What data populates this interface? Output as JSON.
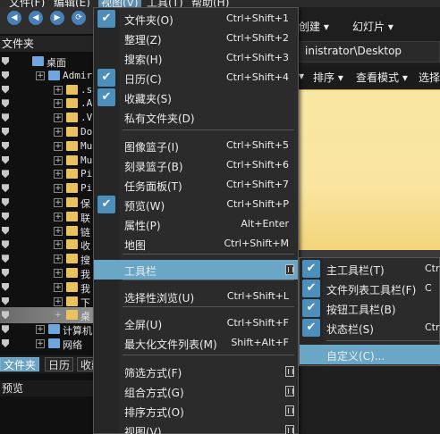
{
  "menubar": {
    "items": [
      {
        "label": "文件(F)"
      },
      {
        "label": "编辑(E)"
      },
      {
        "label": "视图(V)",
        "active": true
      },
      {
        "label": "工具(T)"
      },
      {
        "label": "帮助(H)"
      }
    ]
  },
  "left_panel": {
    "title": "文件夹",
    "tree": [
      {
        "label": "桌面",
        "indent": 1
      },
      {
        "label": "Admir",
        "indent": 2
      },
      {
        "label": ".s",
        "indent": 3
      },
      {
        "label": ".A",
        "indent": 3
      },
      {
        "label": ".V",
        "indent": 3
      },
      {
        "label": "Do",
        "indent": 3
      },
      {
        "label": "Mu",
        "indent": 3
      },
      {
        "label": "Mu",
        "indent": 3
      },
      {
        "label": "Pi",
        "indent": 3
      },
      {
        "label": "Pi",
        "indent": 3
      },
      {
        "label": "保",
        "indent": 3
      },
      {
        "label": "联",
        "indent": 3
      },
      {
        "label": "链",
        "indent": 3
      },
      {
        "label": "收",
        "indent": 3
      },
      {
        "label": "搜",
        "indent": 3
      },
      {
        "label": "我",
        "indent": 3
      },
      {
        "label": "我",
        "indent": 3
      },
      {
        "label": "下",
        "indent": 3
      },
      {
        "label": "桌",
        "indent": 3
      },
      {
        "label": "计算机",
        "indent": 2
      },
      {
        "label": "网络",
        "indent": 2
      }
    ],
    "bottom_tabs": [
      "文件夹",
      "日历",
      "收藏"
    ],
    "preview_title": "预览"
  },
  "right_area": {
    "topbar_items": [
      "创建 ▾",
      "幻灯片 ▾"
    ],
    "address": "inistrator\\Desktop",
    "viewbar_items": [
      "▾",
      "排序 ▾",
      "查看模式 ▾",
      "选择"
    ]
  },
  "view_menu": {
    "items": [
      {
        "label": "文件夹(O)",
        "shortcut": "Ctrl+Shift+1",
        "checked": true
      },
      {
        "label": "整理(Z)",
        "shortcut": "Ctrl+Shift+2"
      },
      {
        "label": "搜索(H)",
        "shortcut": "Ctrl+Shift+3"
      },
      {
        "label": "日历(C)",
        "shortcut": "Ctrl+Shift+4",
        "checked": true
      },
      {
        "label": "收藏夹(S)",
        "checked": true
      },
      {
        "label": "私有文件夹(D)"
      },
      {
        "label": "图像篮子(I)",
        "shortcut": "Ctrl+Shift+5"
      },
      {
        "label": "刻录篮子(B)",
        "shortcut": "Ctrl+Shift+6"
      },
      {
        "label": "任务面板(T)",
        "shortcut": "Ctrl+Shift+7"
      },
      {
        "label": "预览(W)",
        "shortcut": "Ctrl+Shift+P",
        "checked": true
      },
      {
        "label": "属性(P)",
        "shortcut": "Alt+Enter"
      },
      {
        "label": "地图",
        "shortcut": "Ctrl+Shift+M"
      },
      {
        "label": "工具栏",
        "submenu": true,
        "highlighted": true
      },
      {
        "label": "选择性浏览(U)",
        "shortcut": "Ctrl+Shift+L"
      },
      {
        "label": "全屏(U)",
        "shortcut": "Ctrl+Shift+F"
      },
      {
        "label": "最大化文件列表(M)",
        "shortcut": "Shift+Alt+F"
      },
      {
        "label": "筛选方式(F)",
        "submenu": true
      },
      {
        "label": "组合方式(G)",
        "submenu": true
      },
      {
        "label": "排序方式(O)",
        "submenu": true
      },
      {
        "label": "视图(V)",
        "submenu": true
      }
    ]
  },
  "toolbar_submenu": {
    "items": [
      {
        "label": "主工具栏(T)",
        "shortcut": "Ctrl",
        "checked": true
      },
      {
        "label": "文件列表工具栏(F)",
        "shortcut": "C",
        "checked": true
      },
      {
        "label": "按钮工具栏(B)",
        "checked": true
      },
      {
        "label": "状态栏(S)",
        "shortcut": "Ctrl",
        "checked": true
      },
      {
        "label": "自定义(C)...",
        "highlighted": true
      }
    ]
  },
  "colors": {
    "highlight": "#6aa7c7",
    "checkbox": "#4c8fbd",
    "menu_bg": "#2b2b2b"
  }
}
